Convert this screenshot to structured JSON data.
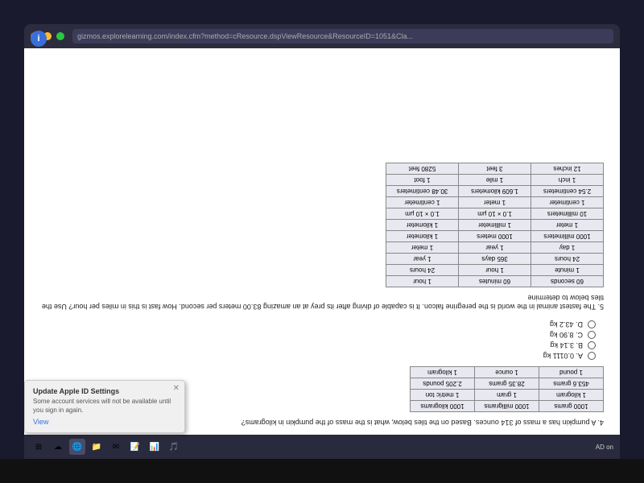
{
  "browser": {
    "address": "gizmos.explorelearning.com/index.cfm?method=cResource.dspViewResource&ResourceID=1051&Cla...",
    "back_label": "←",
    "forward_label": "→",
    "refresh_label": "↻"
  },
  "question4": {
    "text": "4. A pumpkin has a mass of 314 ounces. Based on the tiles below, what is the mass of the pumpkin in kilograms?",
    "tiles_row1": [
      "1000 grams",
      "1000 milligrams",
      "1000 kilograms"
    ],
    "tiles_row2": [
      "1 kilogram",
      "1 gram",
      "1 metric ton"
    ],
    "tiles_row3": [
      "453.6 grams",
      "28.35 grams",
      "2.205 pounds"
    ],
    "tiles_row4": [
      "1 pound",
      "1 ounce",
      "1 kilogram"
    ],
    "answer_options": [
      {
        "label": "A. 0.0111 kg",
        "id": "A"
      },
      {
        "label": "B. 3.14 kg",
        "id": "B"
      },
      {
        "label": "C. 8.90 kg",
        "id": "C"
      },
      {
        "label": "D. 43.2 kg",
        "id": "D"
      }
    ]
  },
  "question5": {
    "text": "5. The fastest animal in the world is the peregrine falcon. It is capable of diving after its prey at an amazing 83.00 meters per second. How fast is this in miles per hour? Use the tiles below to determine",
    "tiles": {
      "row1": [
        "60 seconds",
        "60 minutes",
        "1 hour"
      ],
      "row2": [
        "1 minute",
        "1 hour",
        "24 hours"
      ],
      "row3": [
        "24 hours",
        "365 days",
        "1 year"
      ],
      "row4": [
        "1 day",
        "1 year",
        "1 meter"
      ],
      "row5": [
        "1000 millimeters",
        "1000 meters",
        "1 kilometer"
      ],
      "row6": [
        "1 meter",
        "1 millimeter",
        "1 kilometer"
      ],
      "row7": [
        "10 millimeters",
        "1.0 × 10 μm",
        "1.0 × 10 μm"
      ],
      "row8": [
        "1 centimeter",
        "1 meter",
        "1 centimeter"
      ],
      "row9": [
        "2.54 centimeters",
        "1.609 kilometers",
        "30.48 centimeters"
      ],
      "row10": [
        "1 inch",
        "1 mile",
        "1 foot"
      ],
      "row11": [
        "12 inches",
        "3 feet",
        "5280 feet"
      ]
    }
  },
  "notification": {
    "title": "Update Apple ID Settings",
    "text": "Some account services will not be available until you sign in again.",
    "view_label": "View"
  },
  "taskbar": {
    "icons": [
      "⊞",
      "☁",
      "🔵",
      "📁",
      "✉",
      "📝",
      "🌐",
      "📊",
      "🎵"
    ],
    "system_info": "AD on"
  },
  "ad_label": "AD on"
}
